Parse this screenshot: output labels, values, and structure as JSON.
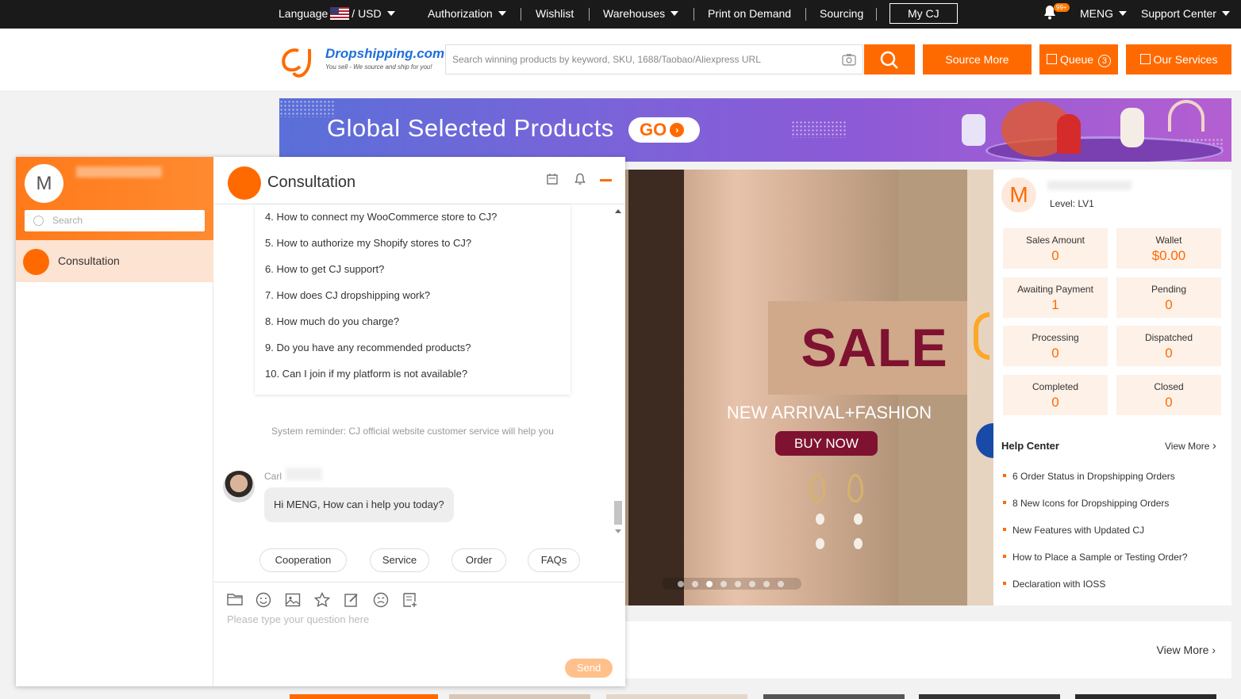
{
  "topbar": {
    "language_label": "Language",
    "currency": "/ USD",
    "authorization": "Authorization",
    "wishlist": "Wishlist",
    "warehouses": "Warehouses",
    "print_on_demand": "Print on Demand",
    "sourcing": "Sourcing",
    "my_cj": "My CJ",
    "bell_badge": "99+",
    "user": "MENG",
    "support": "Support Center"
  },
  "header": {
    "logo_brand": "Dropshipping.com",
    "logo_tagline": "You sell - We source and ship for you!",
    "search_placeholder": "Search winning products by keyword, SKU, 1688/Taobao/Aliexpress URL",
    "source_more": "Source More",
    "queue": "Queue",
    "queue_count": "3",
    "our_services": "Our Services"
  },
  "banner": {
    "title": "Global Selected Products",
    "go": "GO"
  },
  "hero": {
    "sale": "SALE",
    "subtitle": "NEW ARRIVAL+FASHION",
    "button": "BUY NOW",
    "pages": 8,
    "active_page": 3
  },
  "account": {
    "avatar_letter": "M",
    "level": "Level: LV1",
    "stats": [
      {
        "label": "Sales Amount",
        "value": "0"
      },
      {
        "label": "Wallet",
        "value": "$0.00"
      },
      {
        "label": "Awaiting Payment",
        "value": "1"
      },
      {
        "label": "Pending",
        "value": "0"
      },
      {
        "label": "Processing",
        "value": "0"
      },
      {
        "label": "Dispatched",
        "value": "0"
      },
      {
        "label": "Completed",
        "value": "0"
      },
      {
        "label": "Closed",
        "value": "0"
      }
    ],
    "help_center": "Help Center",
    "view_more": "View More",
    "help_items": [
      "6 Order Status in Dropshipping Orders",
      "8 New Icons for Dropshipping Orders",
      "New Features with Updated CJ",
      "How to Place a Sample or Testing Order?",
      "Declaration with IOSS"
    ]
  },
  "bottom": {
    "view_more": "View More"
  },
  "chat": {
    "user_letter": "M",
    "search_placeholder": "Search",
    "conversation": "Consultation",
    "title": "Consultation",
    "faqs": [
      "4. How to connect my WooCommerce store to CJ?",
      "5. How to authorize my Shopify stores to CJ?",
      "6. How to get CJ support?",
      "7. How does CJ dropshipping work?",
      "8. How much do you charge?",
      "9. Do you have any recommended products?",
      "10. Can I join if my platform is not available?"
    ],
    "system_reminder": "System reminder: CJ official website customer service will help you",
    "agent_name": "Carl",
    "agent_message": "Hi MENG, How can i help you today?",
    "quick_replies": [
      "Cooperation",
      "Service",
      "Order",
      "FAQs"
    ],
    "input_placeholder": "Please type your question here",
    "send": "Send"
  }
}
